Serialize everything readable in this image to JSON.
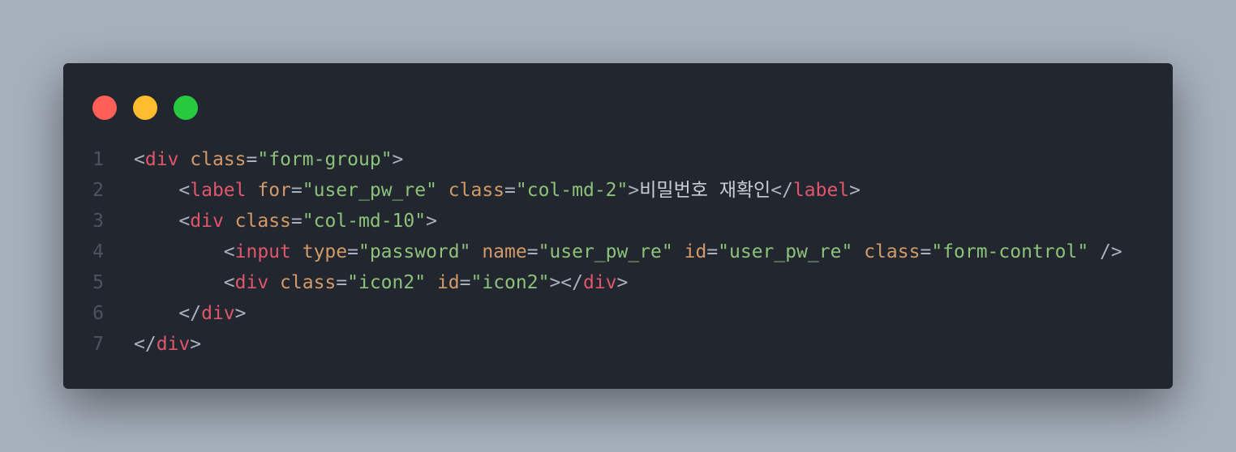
{
  "window": {
    "controls": [
      {
        "name": "close",
        "color": "#ff5f56"
      },
      {
        "name": "minimize",
        "color": "#ffbd2e"
      },
      {
        "name": "maximize",
        "color": "#27c93f"
      }
    ]
  },
  "code": {
    "lines": [
      {
        "n": "1",
        "tokens": [
          [
            "p",
            "<"
          ],
          [
            "t",
            "div"
          ],
          [
            "p",
            " "
          ],
          [
            "a",
            "class"
          ],
          [
            "p",
            "="
          ],
          [
            "s",
            "\"form-group\""
          ],
          [
            "p",
            ">"
          ]
        ]
      },
      {
        "n": "2",
        "tokens": [
          [
            "p",
            "    <"
          ],
          [
            "t",
            "label"
          ],
          [
            "p",
            " "
          ],
          [
            "a",
            "for"
          ],
          [
            "p",
            "="
          ],
          [
            "s",
            "\"user_pw_re\""
          ],
          [
            "p",
            " "
          ],
          [
            "a",
            "class"
          ],
          [
            "p",
            "="
          ],
          [
            "s",
            "\"col-md-2\""
          ],
          [
            "p",
            ">"
          ],
          [
            "x",
            "비밀번호 재확인"
          ],
          [
            "p",
            "</"
          ],
          [
            "t",
            "label"
          ],
          [
            "p",
            ">"
          ]
        ]
      },
      {
        "n": "3",
        "tokens": [
          [
            "p",
            "    <"
          ],
          [
            "t",
            "div"
          ],
          [
            "p",
            " "
          ],
          [
            "a",
            "class"
          ],
          [
            "p",
            "="
          ],
          [
            "s",
            "\"col-md-10\""
          ],
          [
            "p",
            ">"
          ]
        ]
      },
      {
        "n": "4",
        "tokens": [
          [
            "p",
            "        <"
          ],
          [
            "t",
            "input"
          ],
          [
            "p",
            " "
          ],
          [
            "a",
            "type"
          ],
          [
            "p",
            "="
          ],
          [
            "s",
            "\"password\""
          ],
          [
            "p",
            " "
          ],
          [
            "a",
            "name"
          ],
          [
            "p",
            "="
          ],
          [
            "s",
            "\"user_pw_re\""
          ],
          [
            "p",
            " "
          ],
          [
            "a",
            "id"
          ],
          [
            "p",
            "="
          ],
          [
            "s",
            "\"user_pw_re\""
          ],
          [
            "p",
            " "
          ],
          [
            "a",
            "class"
          ],
          [
            "p",
            "="
          ],
          [
            "s",
            "\"form-control\""
          ],
          [
            "p",
            " />"
          ]
        ]
      },
      {
        "n": "5",
        "tokens": [
          [
            "p",
            "        <"
          ],
          [
            "t",
            "div"
          ],
          [
            "p",
            " "
          ],
          [
            "a",
            "class"
          ],
          [
            "p",
            "="
          ],
          [
            "s",
            "\"icon2\""
          ],
          [
            "p",
            " "
          ],
          [
            "a",
            "id"
          ],
          [
            "p",
            "="
          ],
          [
            "s",
            "\"icon2\""
          ],
          [
            "p",
            "></"
          ],
          [
            "t",
            "div"
          ],
          [
            "p",
            ">"
          ]
        ]
      },
      {
        "n": "6",
        "tokens": [
          [
            "p",
            "    </"
          ],
          [
            "t",
            "div"
          ],
          [
            "p",
            ">"
          ]
        ]
      },
      {
        "n": "7",
        "tokens": [
          [
            "p",
            "</"
          ],
          [
            "t",
            "div"
          ],
          [
            "p",
            ">"
          ]
        ]
      }
    ]
  }
}
